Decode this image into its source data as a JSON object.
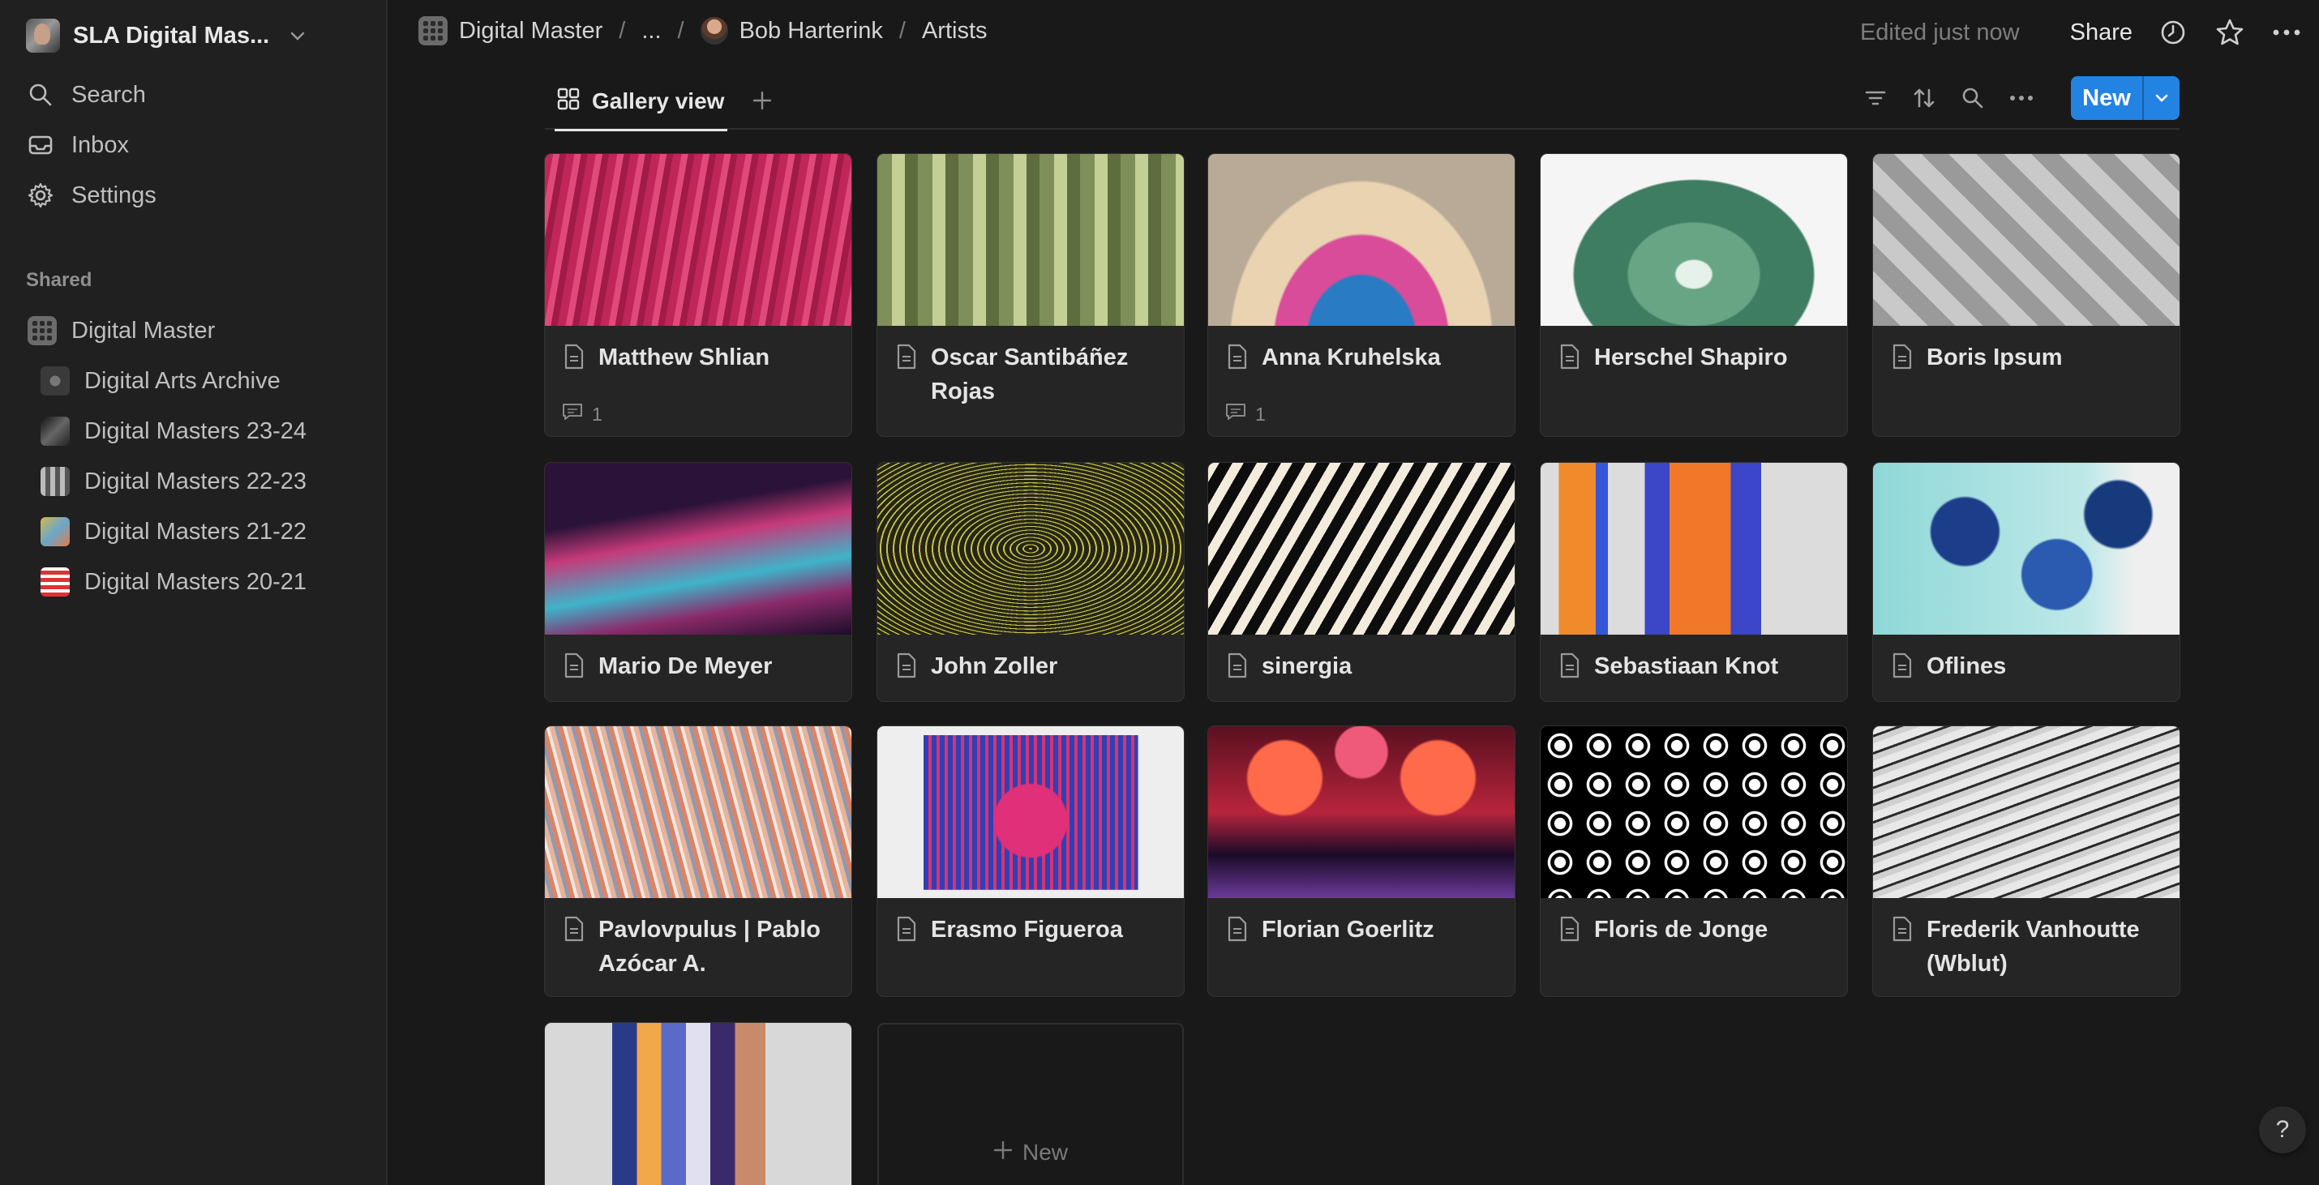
{
  "sidebar": {
    "workspace": "SLA Digital Mas...",
    "nav": [
      {
        "label": "Search",
        "icon": "search-icon"
      },
      {
        "label": "Inbox",
        "icon": "inbox-icon"
      },
      {
        "label": "Settings",
        "icon": "gear-icon"
      }
    ],
    "section": "Shared",
    "tree": [
      {
        "label": "Digital Master"
      },
      {
        "label": "Digital Arts Archive"
      },
      {
        "label": "Digital Masters 23-24"
      },
      {
        "label": "Digital Masters 22-23"
      },
      {
        "label": "Digital Masters 21-22"
      },
      {
        "label": "Digital Masters 20-21"
      }
    ]
  },
  "topbar": {
    "crumbs": [
      "Digital Master",
      "...",
      "Bob Harterink",
      "Artists"
    ],
    "edited": "Edited just now",
    "share": "Share"
  },
  "view": {
    "tab": "Gallery view",
    "new_label": "New"
  },
  "gallery": [
    {
      "title": "Matthew Shlian",
      "comments": "1"
    },
    {
      "title": "Oscar Santibáñez Rojas",
      "comments": ""
    },
    {
      "title": "Anna Kruhelska",
      "comments": "1"
    },
    {
      "title": "Herschel Shapiro",
      "comments": ""
    },
    {
      "title": "Boris Ipsum",
      "comments": ""
    },
    {
      "title": "Mario De Meyer",
      "comments": ""
    },
    {
      "title": "John Zoller",
      "comments": ""
    },
    {
      "title": "sinergia",
      "comments": ""
    },
    {
      "title": "Sebastiaan Knot",
      "comments": ""
    },
    {
      "title": "Oflines",
      "comments": ""
    },
    {
      "title": "Pavlovpulus | Pablo Azócar A.",
      "comments": ""
    },
    {
      "title": "Erasmo Figueroa",
      "comments": ""
    },
    {
      "title": "Florian Goerlitz",
      "comments": ""
    },
    {
      "title": "Floris de Jonge",
      "comments": ""
    },
    {
      "title": "Frederik Vanhoutte (Wblut)",
      "comments": ""
    },
    {
      "title": "",
      "comments": ""
    }
  ],
  "new_card_label": "New",
  "help": "?"
}
